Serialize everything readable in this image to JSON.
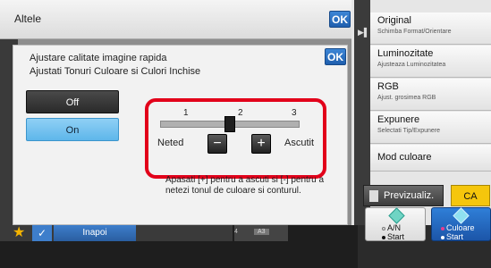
{
  "topbar": {
    "title": "Altele",
    "ok_label": "OK"
  },
  "dialog": {
    "title_line1": "Ajustare calitate imagine rapida",
    "title_line2": "Ajustati Tonuri Culoare si Culori Inchise",
    "ok_label": "OK",
    "options": [
      {
        "label": "Off",
        "selected": false
      },
      {
        "label": "On",
        "selected": true
      }
    ],
    "slider": {
      "ticks": [
        "1",
        "2",
        "3"
      ],
      "value": 2,
      "min": 1,
      "max": 3,
      "left_label": "Neted",
      "right_label": "Ascutit",
      "minus_label": "−",
      "plus_label": "+"
    },
    "hint": "Apasati [+] pentru a ascuti si [-] pentru a netezi tonul de culoare si conturul."
  },
  "right_panel": {
    "items": [
      {
        "label": "Original",
        "sublabel": "Schimba Format/Orientare"
      },
      {
        "label": "Luminozitate",
        "sublabel": "Ajusteaza Luminozitatea"
      },
      {
        "label": "RGB",
        "sublabel": "Ajust. grosimea RGB"
      },
      {
        "label": "Expunere",
        "sublabel": "Selectati Tip/Expunere"
      },
      {
        "label": "Mod culoare",
        "sublabel": ""
      }
    ],
    "preview_label": "Previzualiz.",
    "ca_label": "CA"
  },
  "bottom": {
    "back_label": "Inapoi",
    "paper_number": "4",
    "paper_size": "A3",
    "start_bw_line1": "A/N",
    "start_bw_line2": "Start",
    "start_color_line1": "Culoare",
    "start_color_line2": "Start"
  },
  "colors": {
    "accent_blue": "#2f7fd8",
    "highlight_red": "#e2001a",
    "ca_yellow": "#f5c60c"
  }
}
